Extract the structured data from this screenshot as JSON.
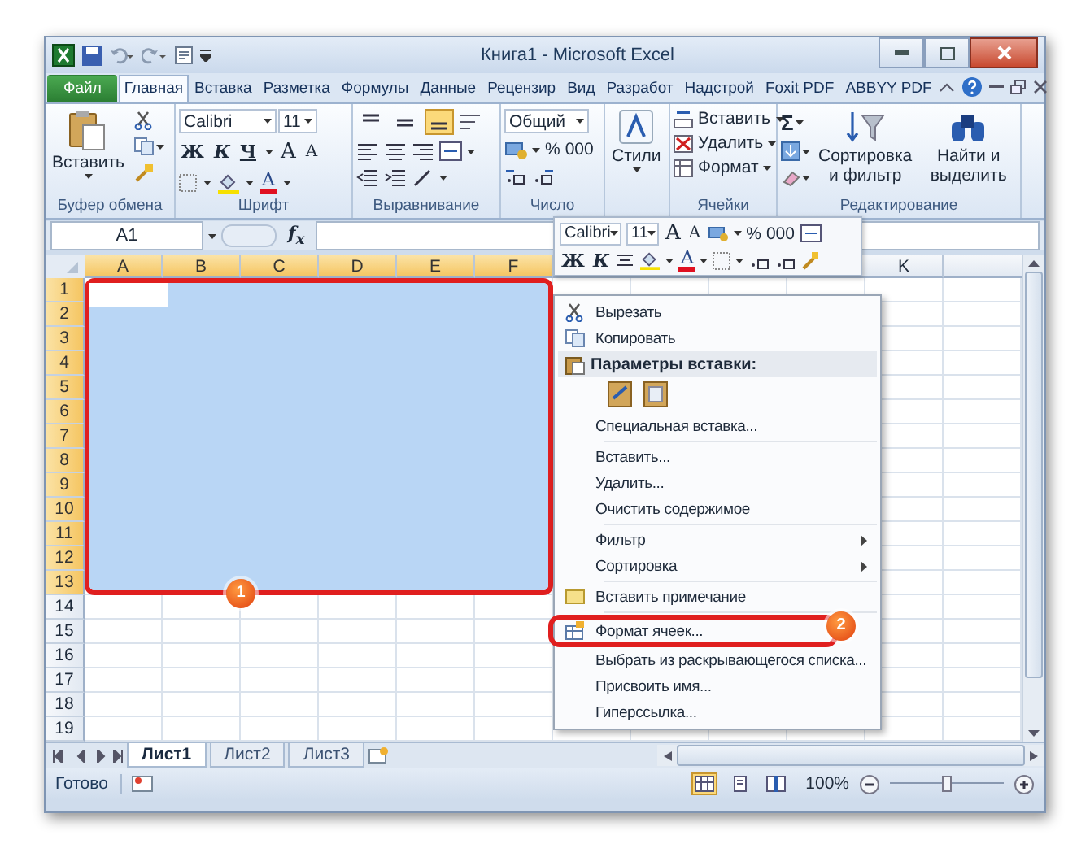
{
  "window": {
    "title": "Книга1 - Microsoft Excel"
  },
  "ribbon_tabs": [
    {
      "label": "Файл",
      "kind": "file",
      "selected": false
    },
    {
      "label": "Главная",
      "kind": "tab",
      "selected": true
    },
    {
      "label": "Вставка",
      "kind": "tab",
      "selected": false
    },
    {
      "label": "Разметка",
      "kind": "tab",
      "selected": false
    },
    {
      "label": "Формулы",
      "kind": "tab",
      "selected": false
    },
    {
      "label": "Данные",
      "kind": "tab",
      "selected": false
    },
    {
      "label": "Рецензир",
      "kind": "tab",
      "selected": false
    },
    {
      "label": "Вид",
      "kind": "tab",
      "selected": false
    },
    {
      "label": "Разработ",
      "kind": "tab",
      "selected": false
    },
    {
      "label": "Надстрой",
      "kind": "tab",
      "selected": false
    },
    {
      "label": "Foxit PDF",
      "kind": "tab",
      "selected": false
    },
    {
      "label": "ABBYY PDF",
      "kind": "tab",
      "selected": false
    }
  ],
  "ribbon": {
    "clipboard": {
      "label": "Буфер обмена",
      "paste": "Вставить"
    },
    "font": {
      "label": "Шрифт",
      "font_name": "Calibri",
      "font_size": "11",
      "bold": "Ж",
      "italic": "К",
      "underline": "Ч",
      "grow": "A",
      "shrink": "A",
      "font_color": "A"
    },
    "alignment": {
      "label": "Выравнивание",
      "vertical": [
        {
          "kind": "top",
          "selected": false
        },
        {
          "kind": "middle",
          "selected": false
        },
        {
          "kind": "bottom",
          "selected": true
        }
      ]
    },
    "number": {
      "label": "Число",
      "format": "Общий",
      "percent": "%",
      "thousands": "000"
    },
    "styles": {
      "button": "Стили"
    },
    "cells": {
      "label": "Ячейки",
      "insert": "Вставить",
      "delete": "Удалить",
      "format": "Формат"
    },
    "editing": {
      "label": "Редактирование",
      "sum": "Σ",
      "sort": "Сортировка и фильтр",
      "find": "Найти и выделить"
    }
  },
  "formula_bar": {
    "name_box": "A1",
    "function_label": "f$_{x}$"
  },
  "sheet": {
    "columns": [
      {
        "label": "A",
        "selected": true
      },
      {
        "label": "B",
        "selected": true
      },
      {
        "label": "C",
        "selected": true
      },
      {
        "label": "D",
        "selected": true
      },
      {
        "label": "E",
        "selected": true
      },
      {
        "label": "F",
        "selected": true
      }
    ],
    "columns_after_menu": [
      {
        "label": "K",
        "selected": false
      }
    ],
    "rows": [
      {
        "label": "1",
        "selected": true
      },
      {
        "label": "2",
        "selected": true
      },
      {
        "label": "3",
        "selected": true
      },
      {
        "label": "4",
        "selected": true
      },
      {
        "label": "5",
        "selected": true
      },
      {
        "label": "6",
        "selected": true
      },
      {
        "label": "7",
        "selected": true
      },
      {
        "label": "8",
        "selected": true
      },
      {
        "label": "9",
        "selected": true
      },
      {
        "label": "10",
        "selected": true
      },
      {
        "label": "11",
        "selected": true
      },
      {
        "label": "12",
        "selected": true
      },
      {
        "label": "13",
        "selected": true
      },
      {
        "label": "14",
        "selected": false
      },
      {
        "label": "15",
        "selected": false
      },
      {
        "label": "16",
        "selected": false
      },
      {
        "label": "17",
        "selected": false
      },
      {
        "label": "18",
        "selected": false
      },
      {
        "label": "19",
        "selected": false
      }
    ],
    "selection_callout": "1"
  },
  "mini_toolbar": {
    "font_name": "Calibri",
    "font_size": "11",
    "grow": "A",
    "shrink": "A",
    "percent": "%",
    "thousands": "000",
    "bold": "Ж",
    "italic": "К",
    "font_color": "A"
  },
  "context_menu": [
    {
      "kind": "item",
      "label": "Вырезать",
      "submenu": false
    },
    {
      "kind": "item",
      "label": "Копировать",
      "submenu": false
    },
    {
      "kind": "header",
      "label": "Параметры вставки:"
    },
    {
      "kind": "paste-options"
    },
    {
      "kind": "item",
      "label": "Специальная вставка...",
      "submenu": false
    },
    {
      "kind": "separator"
    },
    {
      "kind": "item",
      "label": "Вставить...",
      "submenu": false
    },
    {
      "kind": "item",
      "label": "Удалить...",
      "submenu": false
    },
    {
      "kind": "item",
      "label": "Очистить содержимое",
      "submenu": false
    },
    {
      "kind": "separator"
    },
    {
      "kind": "item",
      "label": "Фильтр",
      "submenu": true
    },
    {
      "kind": "item",
      "label": "Сортировка",
      "submenu": true
    },
    {
      "kind": "separator"
    },
    {
      "kind": "item",
      "label": "Вставить примечание",
      "submenu": false
    },
    {
      "kind": "separator"
    },
    {
      "kind": "item",
      "label": "Формат ячеек...",
      "submenu": false,
      "callout": "2"
    },
    {
      "kind": "item",
      "label": "Выбрать из раскрывающегося списка...",
      "submenu": false
    },
    {
      "kind": "item",
      "label": "Присвоить имя...",
      "submenu": false
    },
    {
      "kind": "item",
      "label": "Гиперссылка...",
      "submenu": false
    }
  ],
  "sheet_tabs": [
    {
      "label": "Лист1",
      "selected": true
    },
    {
      "label": "Лист2",
      "selected": false
    },
    {
      "label": "Лист3",
      "selected": false
    }
  ],
  "status_bar": {
    "text": "Готово",
    "views": [
      {
        "kind": "normal",
        "selected": true
      },
      {
        "kind": "page-layout",
        "selected": false
      },
      {
        "kind": "page-break",
        "selected": false
      }
    ],
    "zoom": "100%",
    "zoom_slider": {
      "level": 0.5
    }
  }
}
